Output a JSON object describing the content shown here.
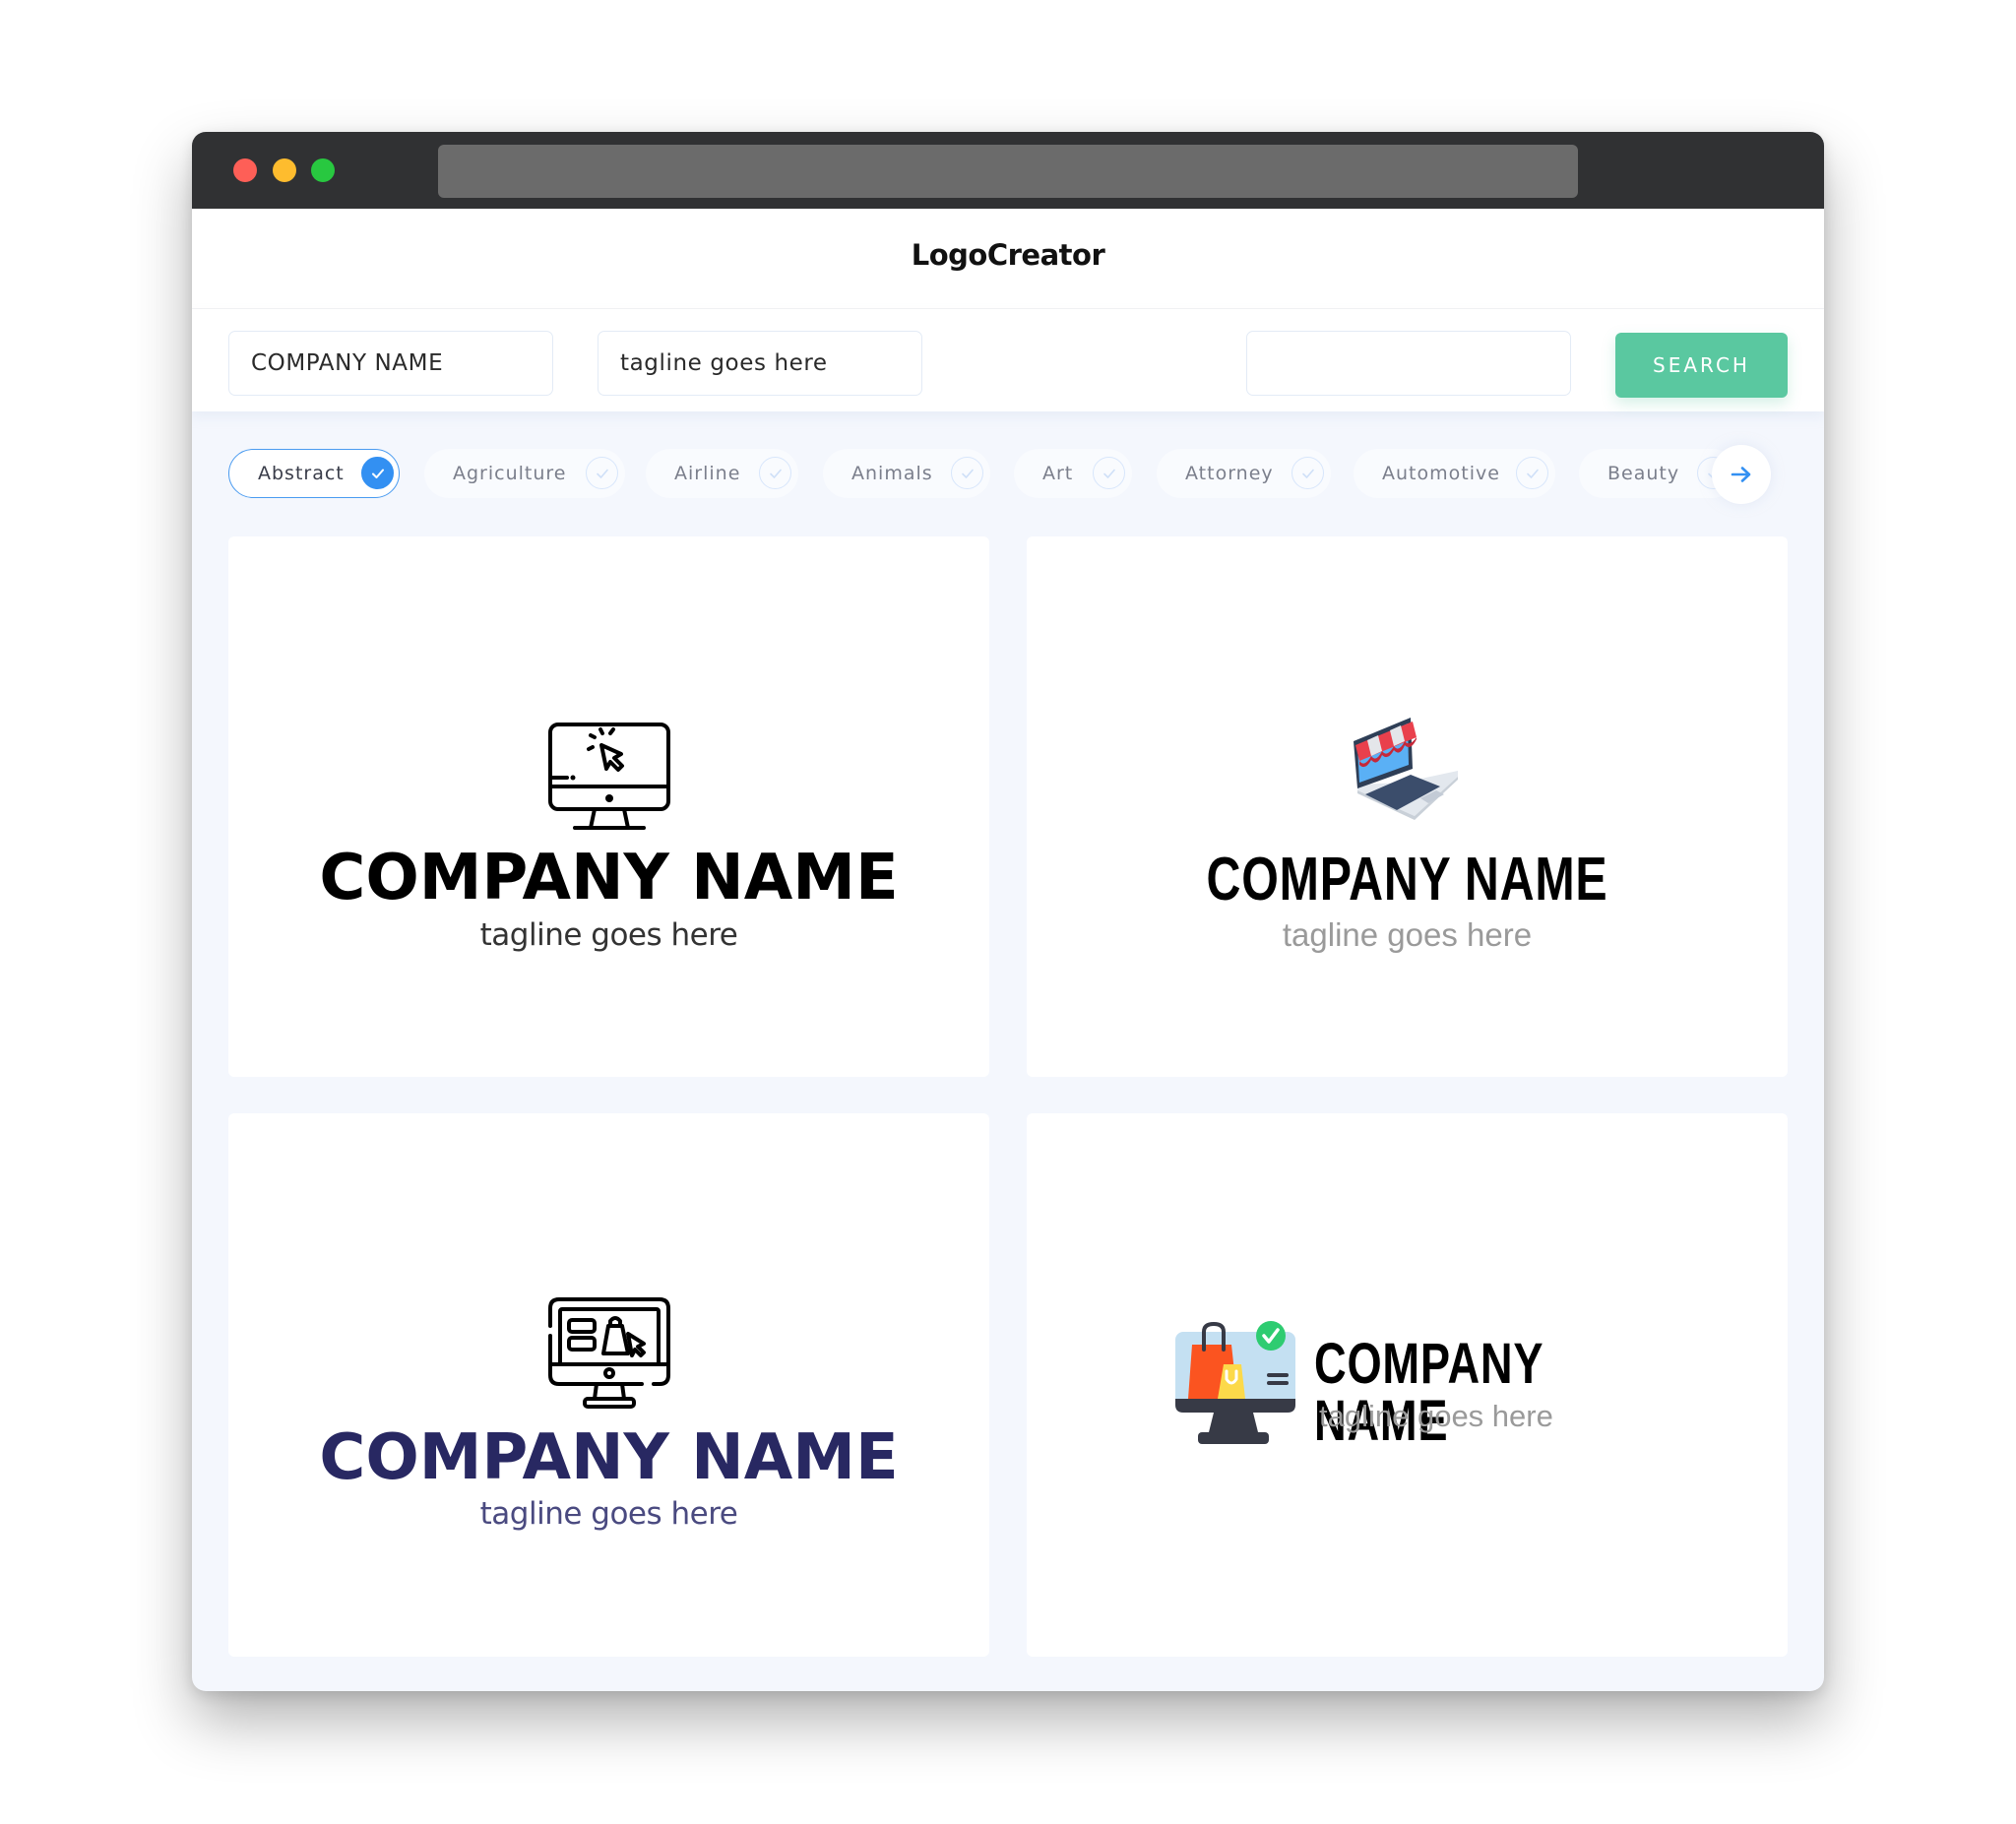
{
  "window": {
    "controls": [
      "close",
      "minimize",
      "maximize"
    ],
    "address_bar": ""
  },
  "header": {
    "title": "LogoCreator"
  },
  "search": {
    "company_name_value": "COMPANY NAME",
    "tagline_value": "tagline goes here",
    "keyword_value": "",
    "search_button_label": "SEARCH"
  },
  "categories": {
    "items": [
      {
        "label": "Abstract",
        "selected": true
      },
      {
        "label": "Agriculture",
        "selected": false
      },
      {
        "label": "Airline",
        "selected": false
      },
      {
        "label": "Animals",
        "selected": false
      },
      {
        "label": "Art",
        "selected": false
      },
      {
        "label": "Attorney",
        "selected": false
      },
      {
        "label": "Automotive",
        "selected": false
      },
      {
        "label": "Beauty",
        "selected": false
      }
    ],
    "next_icon": "arrow-right-icon"
  },
  "logos": [
    {
      "icon": "monitor-cursor-click-icon",
      "company_name": "COMPANY NAME",
      "tagline": "tagline goes here",
      "name_color": "#000000",
      "tagline_color": "#333333"
    },
    {
      "icon": "laptop-storefront-icon",
      "company_name": "COMPANY NAME",
      "tagline": "tagline goes here",
      "name_color": "#000000",
      "tagline_color": "#9a9a9a"
    },
    {
      "icon": "monitor-shopping-bag-icon",
      "company_name": "COMPANY NAME",
      "tagline": "tagline goes here",
      "name_color": "#282862",
      "tagline_color": "#4a4a80"
    },
    {
      "icon": "monitor-shopping-bags-check-icon",
      "company_name": "COMPANY NAME",
      "tagline": "tagline goes here",
      "name_color": "#000000",
      "tagline_color": "#9a9a9a"
    }
  ],
  "colors": {
    "accent_green": "#5ac8a0",
    "accent_blue": "#3390f2",
    "background": "#f4f7fd"
  }
}
